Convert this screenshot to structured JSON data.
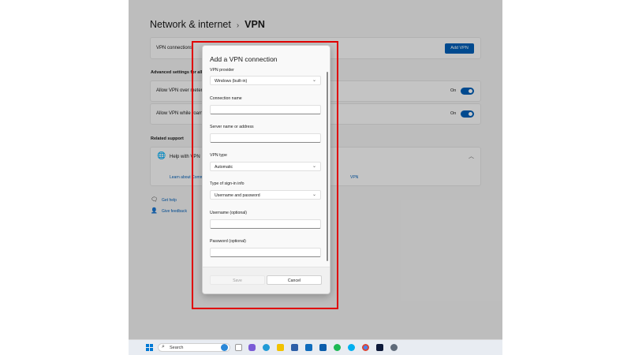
{
  "page": {
    "breadcrumb": {
      "parent": "Network & internet",
      "separator": "›",
      "current": "VPN"
    },
    "vpn_connections": {
      "label": "VPN connections",
      "add_button": "Add VPN"
    },
    "advanced": {
      "heading": "Advanced settings for all VPN connections",
      "rows": [
        {
          "label": "Allow VPN over metered networks",
          "state": "On"
        },
        {
          "label": "Allow VPN while roaming",
          "state": "On"
        }
      ]
    },
    "related": {
      "heading": "Related support",
      "help_title": "Help with VPN",
      "help_link": "Learn about Common VPN issues",
      "help_link_tail": "VPN"
    },
    "footer_links": {
      "get_help": "Get help",
      "give_feedback": "Give feedback"
    }
  },
  "dialog": {
    "title": "Add a VPN connection",
    "vpn_provider": {
      "label": "VPN provider",
      "value": "Windows (built-in)"
    },
    "connection_name": {
      "label": "Connection name",
      "value": ""
    },
    "server": {
      "label": "Server name or address",
      "value": ""
    },
    "vpn_type": {
      "label": "VPN type",
      "value": "Automatic"
    },
    "signin_type": {
      "label": "Type of sign-in info",
      "value": "Username and password"
    },
    "username": {
      "label": "Username (optional)",
      "value": ""
    },
    "password": {
      "label": "Password (optional)",
      "value": ""
    },
    "save_label": "Save",
    "cancel_label": "Cancel"
  },
  "taskbar": {
    "search_placeholder": "Search",
    "icons": [
      "windows-start-icon",
      "search-icon",
      "widgets-icon",
      "chat-icon",
      "edge-icon",
      "file-explorer-icon",
      "store-icon",
      "mail-icon",
      "outlook-icon",
      "spotify-icon",
      "skype-icon",
      "chrome-icon",
      "photoshop-icon",
      "settings-icon"
    ]
  },
  "colors": {
    "accent": "#005fb8",
    "highlight": "#e00000",
    "dialog_bg": "#f9f9f9"
  }
}
